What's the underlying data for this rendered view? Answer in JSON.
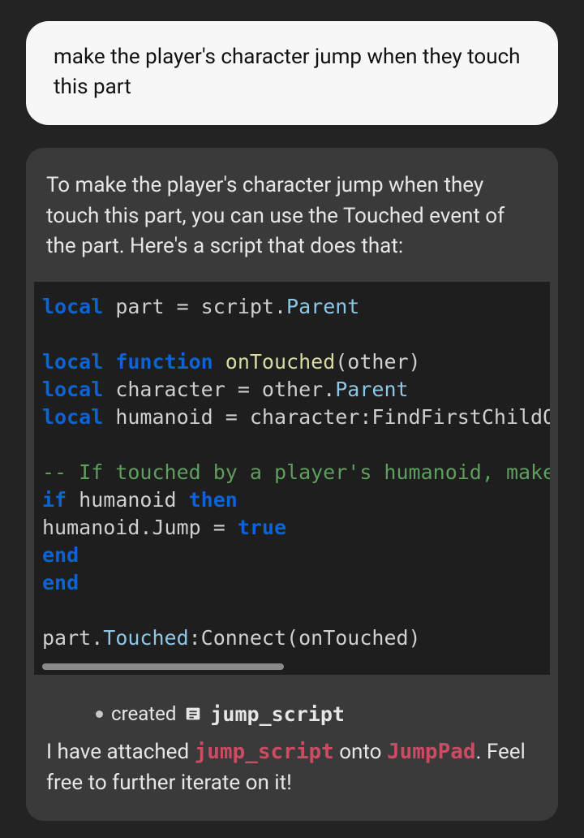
{
  "user": {
    "message": "make the player's character jump when they touch this part"
  },
  "assistant": {
    "intro": "To make the player's character jump when they touch this part, you can use the Touched event of the part. Here's a script that does that:",
    "code": {
      "l1_kw1": "local",
      "l1_txt1": " part = script.",
      "l1_prop1": "Parent",
      "l2_kw1": "local",
      "l2_kw2": " function ",
      "l2_fn": "onTouched",
      "l2_txt1": "(other)",
      "l3_kw1": "local",
      "l3_txt1": " character = other.",
      "l3_prop1": "Parent",
      "l4_kw1": "local",
      "l4_txt1": " humanoid = character:FindFirstChildOfClass(\"Humanoid\")",
      "l5_cmt": "-- If touched by a player's humanoid, make them jump",
      "l6_kw1": "if",
      "l6_txt1": " humanoid ",
      "l6_kw2": "then",
      "l7_txt1": "humanoid.Jump = ",
      "l7_kw1": "true",
      "l8_kw1": "end",
      "l9_kw1": "end",
      "l10_txt1": "part.",
      "l10_prop1": "Touched",
      "l10_txt2": ":Connect(onTouched)"
    },
    "created": {
      "label": "created",
      "script_name": "jump_script"
    },
    "outro": {
      "t1": "I have attached ",
      "script_name": "jump_script",
      "t2": " onto ",
      "object_name": "JumpPad",
      "t3": ". Feel free to further iterate on it!"
    }
  }
}
